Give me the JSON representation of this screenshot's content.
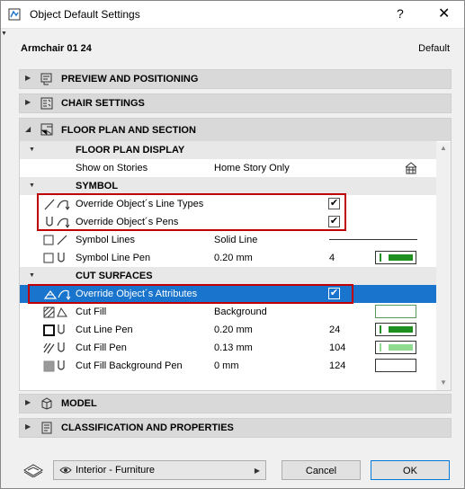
{
  "window": {
    "title": "Object Default Settings",
    "help": "?",
    "close": "✕"
  },
  "header": {
    "object_name": "Armchair 01 24",
    "default_label": "Default"
  },
  "sections": {
    "preview": "PREVIEW AND POSITIONING",
    "chair": "CHAIR SETTINGS",
    "floor_plan": "FLOOR PLAN AND SECTION",
    "model": "MODEL",
    "classification": "CLASSIFICATION AND PROPERTIES"
  },
  "floor_plan": {
    "display_group": "FLOOR PLAN DISPLAY",
    "show_on_stories": {
      "label": "Show on Stories",
      "value": "Home Story Only"
    },
    "symbol_group": "SYMBOL",
    "override_line_types": {
      "label": "Override Object´s Line Types",
      "checked": true
    },
    "override_pens": {
      "label": "Override Object´s Pens",
      "checked": true
    },
    "symbol_lines": {
      "label": "Symbol Lines",
      "value": "Solid Line"
    },
    "symbol_line_pen": {
      "label": "Symbol Line Pen",
      "value": "0.20 mm",
      "pen": "4",
      "pen_color": "#1f8f1f"
    },
    "cut_group": "CUT SURFACES",
    "override_attributes": {
      "label": "Override Object´s Attributes",
      "checked": true
    },
    "cut_fill": {
      "label": "Cut Fill",
      "value": "Background"
    },
    "cut_line_pen": {
      "label": "Cut Line Pen",
      "value": "0.20 mm",
      "pen": "24",
      "pen_color": "#1f8f1f"
    },
    "cut_fill_pen": {
      "label": "Cut Fill Pen",
      "value": "0.13 mm",
      "pen": "104",
      "pen_color": "#8fdc8f"
    },
    "cut_fill_bg_pen": {
      "label": "Cut Fill Background Pen",
      "value": "0 mm",
      "pen": "124",
      "pen_color": "#ffffff"
    }
  },
  "footer": {
    "view_dropdown": "Interior - Furniture",
    "cancel": "Cancel",
    "ok": "OK"
  },
  "colors": {
    "selection": "#1874cd",
    "highlight": "#c00000"
  }
}
